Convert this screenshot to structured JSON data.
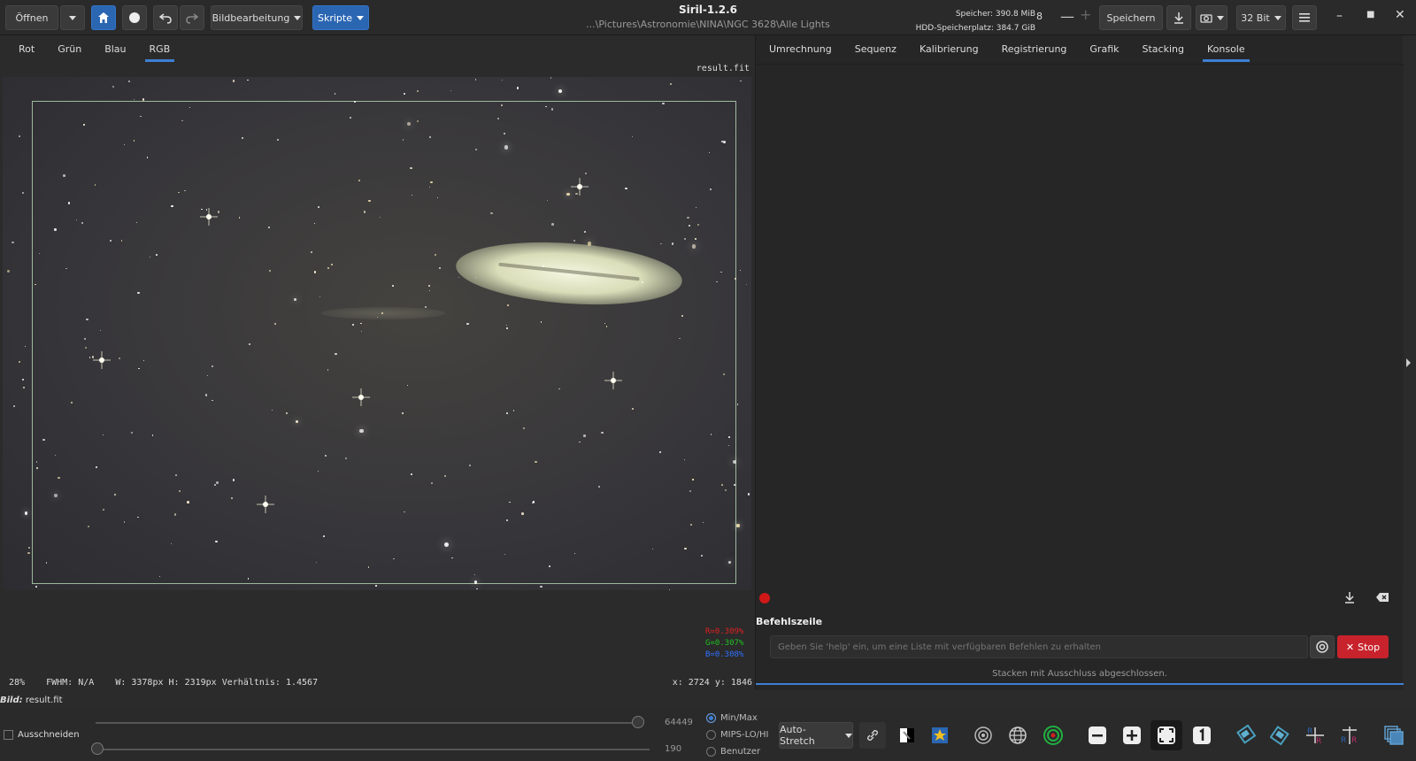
{
  "toolbar": {
    "open_label": "Öffnen",
    "image_processing_label": "Bildbearbeitung",
    "scripts_label": "Skripte",
    "save_label": "Speichern",
    "bitdepth_label": "32 Bit",
    "threads_value": "8"
  },
  "window": {
    "title": "Siril-1.2.6",
    "path": "...\\Pictures\\Astronomie\\NINA\\NGC 3628\\Alle Lights",
    "memory": "Speicher: 390.8 MiB",
    "disk": "HDD-Speicherplatz: 384.7 GiB"
  },
  "left_tabs": [
    "Rot",
    "Grün",
    "Blau",
    "RGB"
  ],
  "right_tabs": [
    "Umrechnung",
    "Sequenz",
    "Kalibrierung",
    "Registrierung",
    "Grafik",
    "Stacking",
    "Konsole"
  ],
  "image": {
    "filename": "result.fit",
    "r_value": "R=0.309%",
    "g_value": "G=0.307%",
    "b_value": "B=0.308%",
    "zoom": "28%",
    "fwhm": "FWHM: N/A",
    "dimensions": "W: 3378px H: 2319px Verhältnis: 1.4567",
    "coords": "x: 2724 y: 1846"
  },
  "console": {
    "commandline_label": "Befehlszeile",
    "input_placeholder": "Geben Sie 'help' ein, um eine Liste mit verfügbaren Befehlen zu erhalten",
    "stop_label": "Stop",
    "status": "Stacken mit Ausschluss abgeschlossen."
  },
  "bottom": {
    "image_label": "Bild:",
    "image_name": "result.fit",
    "crop_label": "Ausschneiden",
    "high_value": "64449",
    "low_value": "190",
    "radio_minmax": "Min/Max",
    "radio_mips": "MIPS-LO/HI",
    "radio_user": "Benutzer",
    "stretch_label": "Auto-Stretch"
  },
  "colors": {
    "accent": "#3e7fd4",
    "stop": "#c8232c",
    "red_text": "#e02020",
    "green_text": "#20c020",
    "blue_text": "#3070ff"
  }
}
